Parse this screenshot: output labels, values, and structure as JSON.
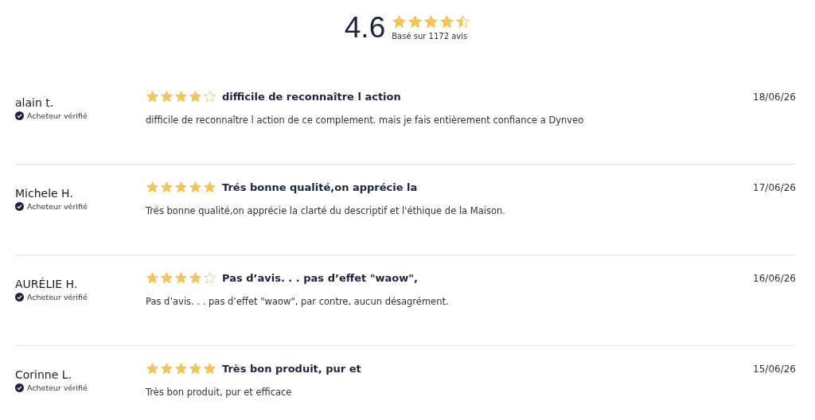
{
  "summary": {
    "rating": "4.6",
    "stars": 4.5,
    "caption": "Basé sur 1172 avis"
  },
  "reviews": [
    {
      "author": "alain t.",
      "badge": "Acheteur vérifié",
      "stars": 4,
      "title": "difficile de reconnaître l action",
      "body": "difficile de reconnaître l action de ce complement. mais je fais entièrement confiance a Dynveo",
      "date": "18/06/26"
    },
    {
      "author": "Michele H.",
      "badge": "Acheteur vérifié",
      "stars": 5,
      "title": "Trés bonne qualité,on apprécie la",
      "body": "Trés bonne qualité,on apprécie la clarté du descriptif et l'éthique de la Maison.",
      "date": "17/06/26"
    },
    {
      "author": "AURÉLIE H.",
      "badge": "Acheteur vérifié",
      "stars": 4,
      "title": "Pas d’avis. . . pas d’effet \"waow\",",
      "body": "Pas d’avis. . . pas d’effet \"waow\", par contre, aucun désagrément.",
      "date": "16/06/26"
    },
    {
      "author": "Corinne L.",
      "badge": "Acheteur vérifié",
      "stars": 5,
      "title": "Très bon produit, pur et",
      "body": "Très bon produit, pur et efficace",
      "date": "15/06/26"
    }
  ]
}
